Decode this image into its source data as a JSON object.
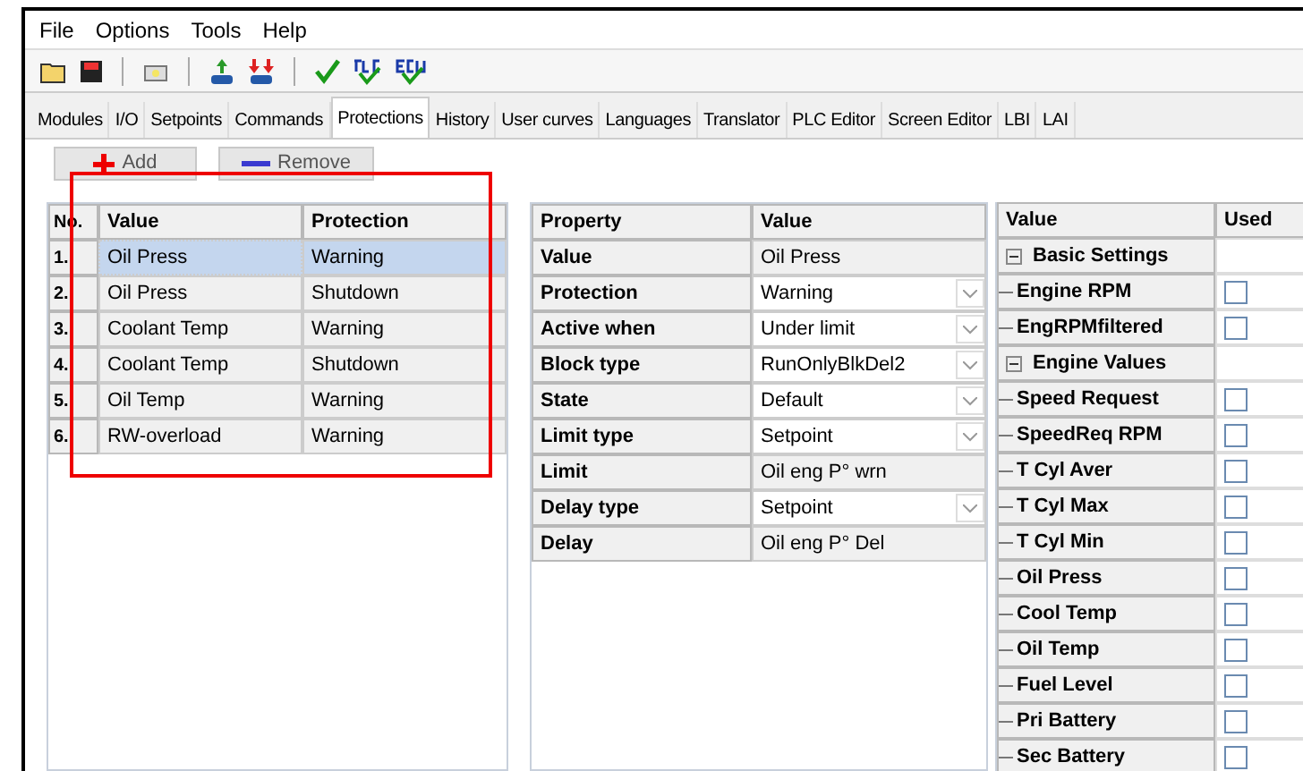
{
  "menu": [
    "File",
    "Options",
    "Tools",
    "Help"
  ],
  "toolbar": [
    {
      "kind": "open"
    },
    {
      "kind": "save"
    },
    {
      "kind": "sep"
    },
    {
      "kind": "connect"
    },
    {
      "kind": "sep"
    },
    {
      "kind": "upload"
    },
    {
      "kind": "download"
    },
    {
      "kind": "sep"
    },
    {
      "kind": "check"
    },
    {
      "kind": "plc"
    },
    {
      "kind": "ecu"
    }
  ],
  "tabs": [
    {
      "label": "Modules",
      "selected": false
    },
    {
      "label": "I/O",
      "selected": false
    },
    {
      "label": "Setpoints",
      "selected": false
    },
    {
      "label": "Commands",
      "selected": false
    },
    {
      "label": "Protections",
      "selected": true
    },
    {
      "label": "History",
      "selected": false
    },
    {
      "label": "User curves",
      "selected": false
    },
    {
      "label": "Languages",
      "selected": false
    },
    {
      "label": "Translator",
      "selected": false
    },
    {
      "label": "PLC Editor",
      "selected": false
    },
    {
      "label": "Screen Editor",
      "selected": false
    },
    {
      "label": "LBI",
      "selected": false
    },
    {
      "label": "LAI",
      "selected": false
    }
  ],
  "buttons": [
    {
      "kind": "add",
      "label": "Add"
    },
    {
      "kind": "remove",
      "label": "Remove"
    }
  ],
  "protections": {
    "columns": [
      "No.",
      "Value",
      "Protection"
    ],
    "rows": [
      {
        "no": "1.",
        "value": "Oil Press",
        "protection": "Warning",
        "selected": true
      },
      {
        "no": "2.",
        "value": "Oil Press",
        "protection": "Shutdown",
        "selected": false
      },
      {
        "no": "3.",
        "value": "Coolant Temp",
        "protection": "Warning",
        "selected": false
      },
      {
        "no": "4.",
        "value": "Coolant Temp",
        "protection": "Shutdown",
        "selected": false
      },
      {
        "no": "5.",
        "value": "Oil Temp",
        "protection": "Warning",
        "selected": false
      },
      {
        "no": "6.",
        "value": "RW-overload",
        "protection": "Warning",
        "selected": false
      }
    ]
  },
  "properties": {
    "columns": [
      "Property",
      "Value"
    ],
    "rows": [
      {
        "name": "Value",
        "value": "Oil Press",
        "kind": "text"
      },
      {
        "name": "Protection",
        "value": "Warning",
        "kind": "dropdown"
      },
      {
        "name": "Active when",
        "value": "Under limit",
        "kind": "dropdown"
      },
      {
        "name": "Block type",
        "value": "RunOnlyBlkDel2",
        "kind": "dropdown"
      },
      {
        "name": "State",
        "value": "Default",
        "kind": "dropdown"
      },
      {
        "name": "Limit type",
        "value": "Setpoint",
        "kind": "dropdown"
      },
      {
        "name": "Limit",
        "value": "Oil eng P° wrn",
        "kind": "text"
      },
      {
        "name": "Delay type",
        "value": "Setpoint",
        "kind": "dropdown"
      },
      {
        "name": "Delay",
        "value": "Oil eng P° Del",
        "kind": "text"
      }
    ]
  },
  "values": {
    "columns": [
      "Value",
      "Used"
    ],
    "groups": [
      {
        "label": "Basic Settings",
        "expanded": true,
        "children": [
          {
            "label": "Engine RPM",
            "checked": false
          },
          {
            "label": "EngRPMfiltered",
            "checked": false
          }
        ]
      },
      {
        "label": "Engine Values",
        "expanded": true,
        "children": [
          {
            "label": "Speed Request",
            "checked": false
          },
          {
            "label": "SpeedReq RPM",
            "checked": false
          },
          {
            "label": "T Cyl Aver",
            "checked": false
          },
          {
            "label": "T Cyl Max",
            "checked": false
          },
          {
            "label": "T Cyl Min",
            "checked": false
          },
          {
            "label": "Oil Press",
            "checked": false
          },
          {
            "label": "Cool Temp",
            "checked": false
          },
          {
            "label": "Oil Temp",
            "checked": false
          },
          {
            "label": "Fuel Level",
            "checked": false
          },
          {
            "label": "Pri Battery",
            "checked": false
          },
          {
            "label": "Sec Battery",
            "checked": false
          }
        ]
      }
    ]
  }
}
